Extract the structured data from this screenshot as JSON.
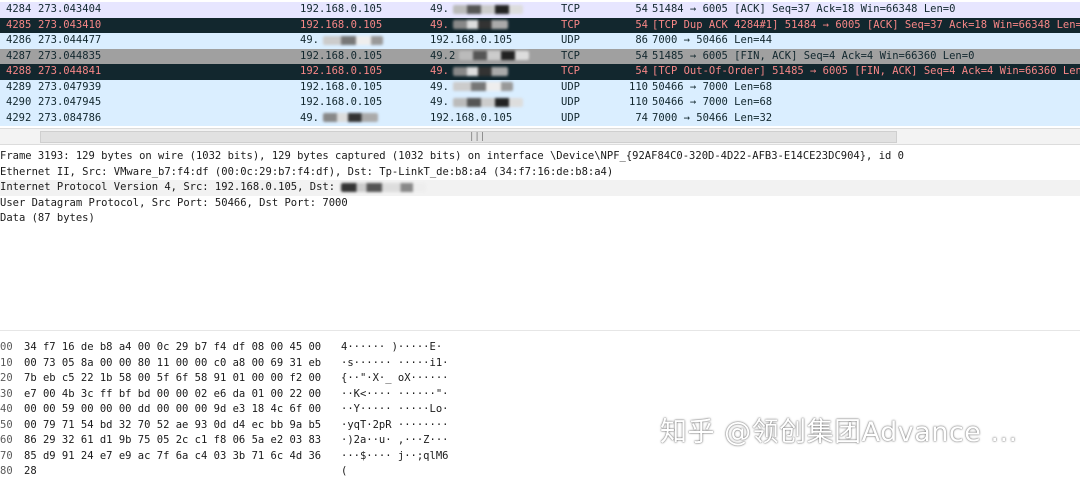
{
  "packet_list": {
    "rows": [
      {
        "no": "4284",
        "time": "273.043404",
        "src": "192.168.0.105",
        "dst": "49.",
        "proto": "TCP",
        "len": "54",
        "info": "51484 → 6005 [ACK] Seq=37 Ack=18 Win=66348 Len=0",
        "style": "light"
      },
      {
        "no": "4285",
        "time": "273.043410",
        "src": "192.168.0.105",
        "dst": "49.",
        "proto": "TCP",
        "len": "54",
        "info": "[TCP Dup ACK 4284#1] 51484 → 6005 [ACK] Seq=37 Ack=18 Win=66348 Len=0",
        "style": "dark"
      },
      {
        "no": "4286",
        "time": "273.044477",
        "src": "49.",
        "dst": "192.168.0.105",
        "proto": "UDP",
        "len": "86",
        "info": "7000 → 50466 Len=44",
        "style": "udp"
      },
      {
        "no": "4287",
        "time": "273.044835",
        "src": "192.168.0.105",
        "dst": "49.2",
        "proto": "TCP",
        "len": "54",
        "info": "51485 → 6005 [FIN, ACK] Seq=4 Ack=4 Win=66360 Len=0",
        "style": "gray"
      },
      {
        "no": "4288",
        "time": "273.044841",
        "src": "192.168.0.105",
        "dst": "49.",
        "proto": "TCP",
        "len": "54",
        "info": "[TCP Out-Of-Order] 51485 → 6005 [FIN, ACK] Seq=4 Ack=4 Win=66360 Len=0",
        "style": "dark"
      },
      {
        "no": "4289",
        "time": "273.047939",
        "src": "192.168.0.105",
        "dst": "49.",
        "proto": "UDP",
        "len": "110",
        "info": "50466 → 7000 Len=68",
        "style": "udp"
      },
      {
        "no": "4290",
        "time": "273.047945",
        "src": "192.168.0.105",
        "dst": "49.",
        "proto": "UDP",
        "len": "110",
        "info": "50466 → 7000 Len=68",
        "style": "udp"
      },
      {
        "no": "4292",
        "time": "273.084786",
        "src": "49.",
        "dst": "192.168.0.105",
        "proto": "UDP",
        "len": "74",
        "info": "7000 → 50466 Len=32",
        "style": "udp"
      }
    ]
  },
  "scrollbar": {
    "grip": "|||"
  },
  "details": {
    "lines": [
      "Frame 3193: 129 bytes on wire (1032 bits), 129 bytes captured (1032 bits) on interface \\Device\\NPF_{92AF84C0-320D-4D22-AFB3-E14CE23DC904}, id 0",
      "Ethernet II, Src: VMware_b7:f4:df (00:0c:29:b7:f4:df), Dst: Tp-LinkT_de:b8:a4 (34:f7:16:de:b8:a4)",
      "Internet Protocol Version 4, Src: 192.168.0.105, Dst:",
      "User Datagram Protocol, Src Port: 50466, Dst Port: 7000",
      "Data (87 bytes)"
    ]
  },
  "hex": {
    "rows": [
      {
        "off": "00",
        "bytes": "34 f7 16 de b8 a4 00 0c  29 b7 f4 df 08 00 45 00",
        "ascii": "4······ )·····E·"
      },
      {
        "off": "10",
        "bytes": "00 73 05 8a 00 00 80 11  00 00 c0 a8 00 69 31 eb",
        "ascii": "·s······ ·····i1·"
      },
      {
        "off": "20",
        "bytes": "7b eb c5 22 1b 58 00 5f  6f 58 91 01 00 00 f2 00",
        "ascii": "{··\"·X·_ oX······"
      },
      {
        "off": "30",
        "bytes": "e7 00 4b 3c ff bf bd 00  00 02 e6 da 01 00 22 00",
        "ascii": "··K<···· ······\"·"
      },
      {
        "off": "40",
        "bytes": "00 00 59 00 00 00 dd 00  00 00 9d e3 18 4c 6f 00",
        "ascii": "··Y····· ·····Lo·"
      },
      {
        "off": "50",
        "bytes": "00 79 71 54 bd 32 70 52  ae 93 0d d4 ec bb 9a b5",
        "ascii": "·yqT·2pR ········"
      },
      {
        "off": "60",
        "bytes": "86 29 32 61 d1 9b 75 05  2c c1 f8 06 5a e2 03 83",
        "ascii": "·)2a··u· ,···Z···"
      },
      {
        "off": "70",
        "bytes": "85 d9 91 24 e7 e9 ac 7f  6a c4 03 3b 71 6c 4d 36",
        "ascii": "···$···· j··;qlM6"
      },
      {
        "off": "80",
        "bytes": "28",
        "ascii": "("
      }
    ]
  },
  "watermark": "知乎 @领创集团Advance ...",
  "colors": {
    "row_light": "#e7e6ff",
    "row_udp": "#daeeff",
    "row_dark": "#12272e",
    "row_dark_text": "#f78787",
    "row_gray": "#a0a0a0"
  }
}
